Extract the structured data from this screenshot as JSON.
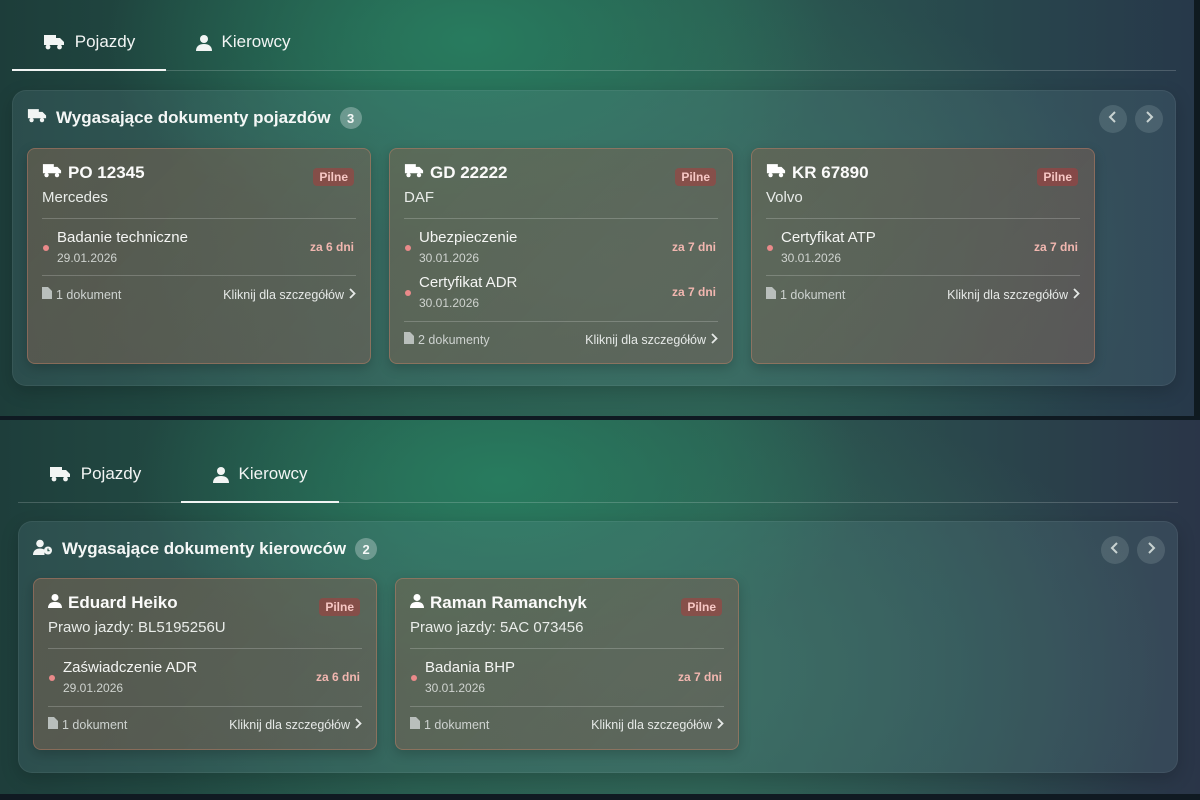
{
  "top_panel": {
    "tabs": [
      {
        "label": "Pojazdy",
        "icon": "truck-icon",
        "active": true
      },
      {
        "label": "Kierowcy",
        "icon": "user-icon",
        "active": false
      }
    ],
    "section": {
      "title": "Wygasające dokumenty pojazdów",
      "count": "3",
      "icon": "truck-icon",
      "cards": [
        {
          "title": "PO 12345",
          "subtitle": "Mercedes",
          "badge": "Pilne",
          "documents": [
            {
              "name": "Badanie techniczne",
              "date": "29.01.2026",
              "days": "za 6 dni"
            }
          ],
          "doc_count": "1 dokument",
          "details": "Kliknij dla szczegółów"
        },
        {
          "title": "GD 22222",
          "subtitle": "DAF",
          "badge": "Pilne",
          "documents": [
            {
              "name": "Ubezpieczenie",
              "date": "30.01.2026",
              "days": "za 7 dni"
            },
            {
              "name": "Certyfikat ADR",
              "date": "30.01.2026",
              "days": "za 7 dni"
            }
          ],
          "doc_count": "2 dokumenty",
          "details": "Kliknij dla szczegółów"
        },
        {
          "title": "KR 67890",
          "subtitle": "Volvo",
          "badge": "Pilne",
          "documents": [
            {
              "name": "Certyfikat ATP",
              "date": "30.01.2026",
              "days": "za 7 dni"
            }
          ],
          "doc_count": "1 dokument",
          "details": "Kliknij dla szczegółów"
        }
      ]
    }
  },
  "bottom_panel": {
    "tabs": [
      {
        "label": "Pojazdy",
        "icon": "truck-icon",
        "active": false
      },
      {
        "label": "Kierowcy",
        "icon": "user-icon",
        "active": true
      }
    ],
    "section": {
      "title": "Wygasające dokumenty kierowców",
      "count": "2",
      "icon": "user-clock-icon",
      "cards": [
        {
          "title": "Eduard Heiko",
          "subtitle": "Prawo jazdy: BL5195256U",
          "badge": "Pilne",
          "documents": [
            {
              "name": "Zaświadczenie ADR",
              "date": "29.01.2026",
              "days": "za 6 dni"
            }
          ],
          "doc_count": "1 dokument",
          "details": "Kliknij dla szczegółów"
        },
        {
          "title": "Raman Ramanchyk",
          "subtitle": "Prawo jazdy: 5AC 073456",
          "badge": "Pilne",
          "documents": [
            {
              "name": "Badania BHP",
              "date": "30.01.2026",
              "days": "za 7 dni"
            }
          ],
          "doc_count": "1 dokument",
          "details": "Kliknij dla szczegółów"
        }
      ]
    }
  },
  "colors": {
    "accent_urgent": "#f2b7b0",
    "dot": "#ea8a8a",
    "badge_bg": "#aa3c3c"
  }
}
